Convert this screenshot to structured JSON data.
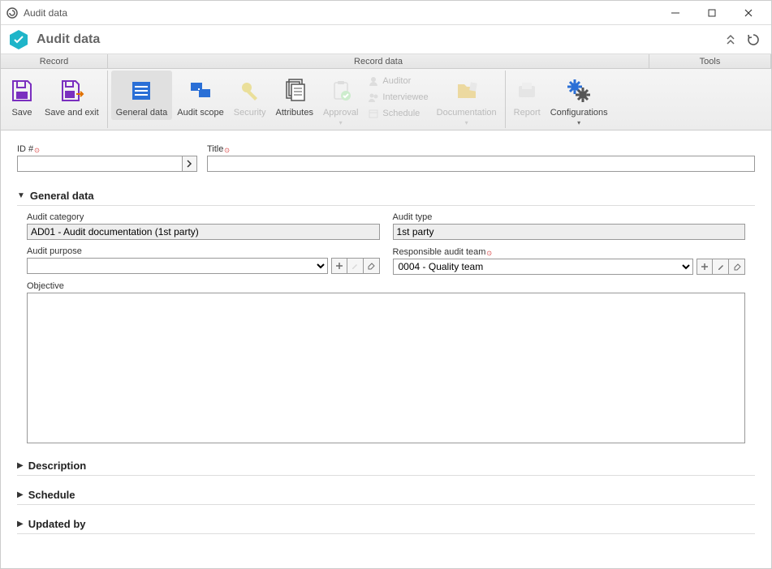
{
  "window": {
    "title": "Audit data"
  },
  "header": {
    "title": "Audit data"
  },
  "ribbonTabs": {
    "record": "Record",
    "recordData": "Record data",
    "tools": "Tools"
  },
  "ribbon": {
    "save": "Save",
    "saveExit": "Save and exit",
    "generalData": "General data",
    "auditScope": "Audit scope",
    "security": "Security",
    "attributes": "Attributes",
    "approval": "Approval",
    "auditor": "Auditor",
    "interviewee": "Interviewee",
    "schedule": "Schedule",
    "documentation": "Documentation",
    "report": "Report",
    "configurations": "Configurations"
  },
  "fields": {
    "id": {
      "label": "ID #",
      "value": ""
    },
    "title": {
      "label": "Title",
      "value": ""
    },
    "auditCategory": {
      "label": "Audit category",
      "value": "AD01 - Audit documentation (1st party)"
    },
    "auditType": {
      "label": "Audit type",
      "value": "1st party"
    },
    "auditPurpose": {
      "label": "Audit purpose",
      "value": ""
    },
    "responsibleTeam": {
      "label": "Responsible audit team",
      "value": "0004 - Quality team"
    },
    "objective": {
      "label": "Objective",
      "value": ""
    }
  },
  "sections": {
    "generalData": "General data",
    "description": "Description",
    "schedule": "Schedule",
    "updatedBy": "Updated by"
  }
}
